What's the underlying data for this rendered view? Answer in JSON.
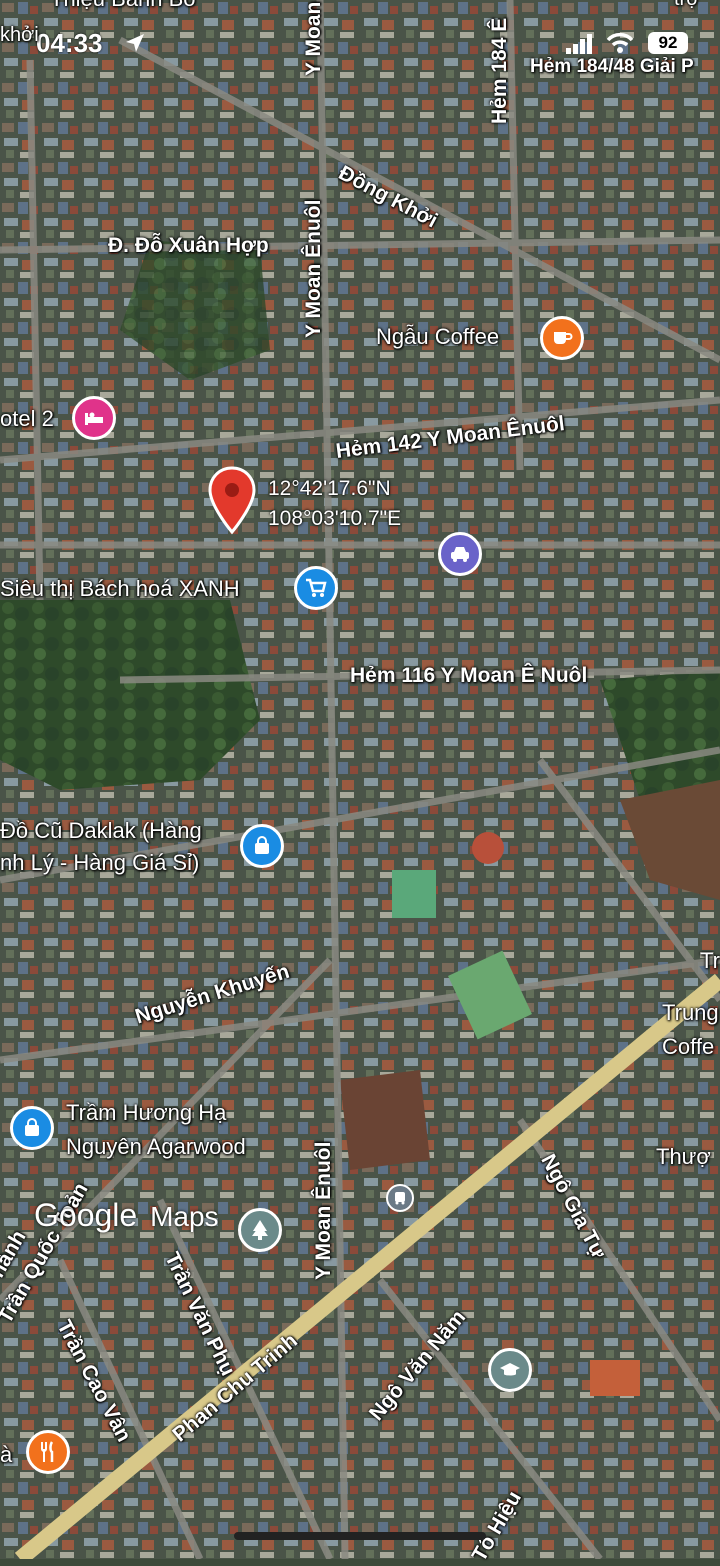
{
  "status_bar": {
    "time": "04:33",
    "battery": "92",
    "icons": [
      "location-arrow-icon",
      "signal-icon",
      "wifi-icon",
      "battery-icon"
    ]
  },
  "dropped_pin": {
    "lat": "12°42'17.6\"N",
    "lng": "108°03'10.7\"E"
  },
  "roads": {
    "do_xuan_hop": "Đ. Đỗ Xuân Hợp",
    "dong_khoi": "Đồng Khởi",
    "y_moan_enuol_top": "Y Moan Ênuôl",
    "hem_184": "Hẻm 184 Ê",
    "hem_184_48": "Hẻm 184/48 Giải P",
    "hem_142": "Hẻm 142 Y Moan Ênuôl",
    "hem_116": "Hẻm 116 Y Moan Ê Nuôl",
    "nguyen_khuyen": "Nguyễn Khuyến",
    "y_moan_enuol_bottom": "Y Moan Ênuôl",
    "ngo_gia_tu": "Ngô Gia Tự",
    "phan_chu_trinh": "Phan Chu Trinh",
    "ngo_van_nam": "Ngô Văn Năm",
    "tran_van_phu": "Trần Văn Phụ",
    "tran_cao_van": "Trần Cao Vân",
    "tran_quoc_to": "Trần Quốc Toản",
    "thanh": "hành",
    "to_hieu": "Tô Hiệu",
    "khoi": "khởi",
    "thieu_banh_bo": "Thiệu Bánh Bò",
    "tro_top": "trợ"
  },
  "pois": {
    "ngau_coffee": "Ngẫu Coffee",
    "hotel_2": "otel 2",
    "bach_hoa_xanh": "Siêu thị Bách hoá XANH",
    "do_cu_daklak_line1": "Đồ Cũ Daklak (Hàng",
    "do_cu_daklak_line2": "nh Lý - Hàng Giá Sỉ)",
    "tram_huong_line1": "Trầm Hương Hạ",
    "tram_huong_line2": "Nguyên Agarwood",
    "trung_coffee_line1": "Trung",
    "trung_coffee_line2": "Coffe",
    "thuong": "Thượ",
    "tr_right": "Tr",
    "a_restaurant": "à"
  },
  "branding": {
    "google": "Google",
    "maps": "Maps"
  },
  "colors": {
    "pin_red": "#e3392c",
    "coffee_orange": "#f2711c",
    "hotel_pink": "#e0338a",
    "shopping_blue": "#1a8ce3",
    "car_purple": "#6a63c9",
    "park_gray": "#6b8a8a",
    "road_yellow": "#d8c889"
  }
}
